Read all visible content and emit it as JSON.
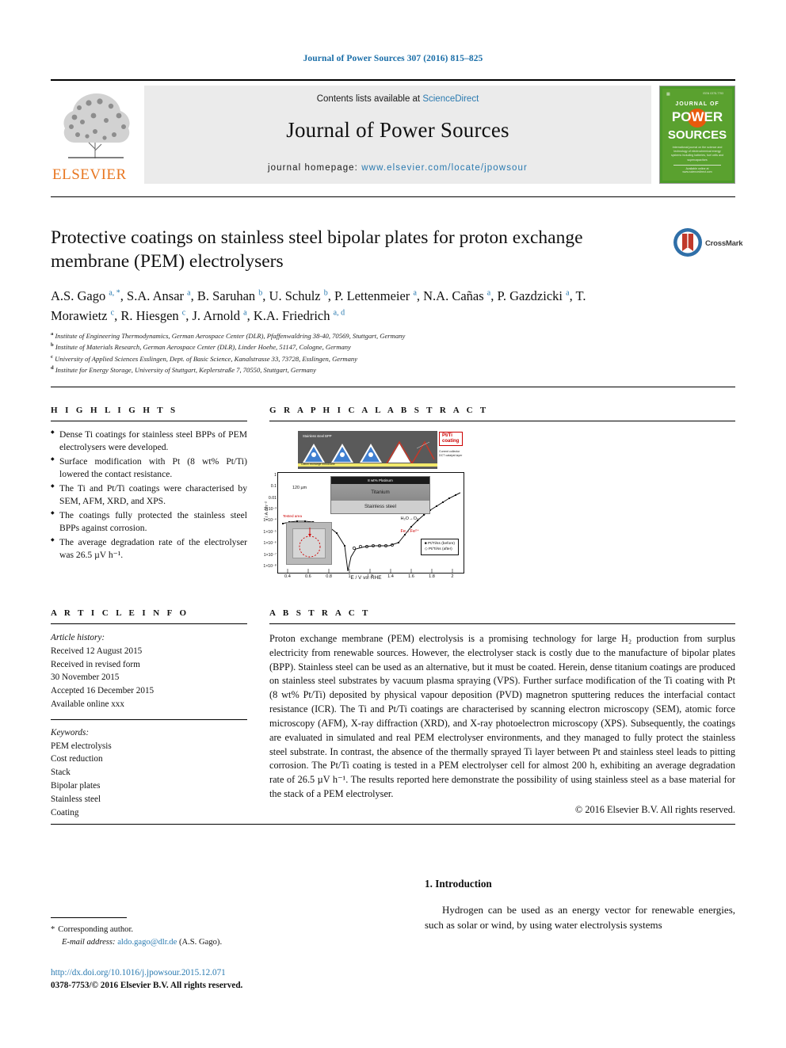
{
  "running_head": "Journal of Power Sources 307 (2016) 815–825",
  "masthead": {
    "contents_prefix": "Contents lists available at ",
    "sciencedirect": "ScienceDirect",
    "journal_title": "Journal of Power Sources",
    "homepage_prefix": "journal homepage: ",
    "homepage_url": "www.elsevier.com/locate/jpowsour",
    "publisher": "ELSEVIER",
    "publisher_icon": "elsevier-tree-logo",
    "cover": {
      "top_left": "ELSEVIER",
      "top_right": "ISSN 0378-7753",
      "line1": "JOURNAL OF",
      "line2": "POWER",
      "line3": "SOURCES",
      "blurb": "International journal on the science and technology of electrochemical energy systems including batteries, fuel cells and supercapacitors",
      "footer": "Available online at www.sciencedirect.com"
    }
  },
  "article": {
    "title": "Protective coatings on stainless steel bipolar plates for proton exchange membrane (PEM) electrolysers",
    "crossmark_label": "CrossMark",
    "authors_html": "A.S. Gago <sup>a, *</sup>, S.A. Ansar <sup>a</sup>, B. Saruhan <sup>b</sup>, U. Schulz <sup>b</sup>, P. Lettenmeier <sup>a</sup>, N.A. Cañas <sup>a</sup>, P. Gazdzicki <sup>a</sup>, T. Morawietz <sup>c</sup>, R. Hiesgen <sup>c</sup>, J. Arnold <sup>a</sup>, K.A. Friedrich <sup>a, d</sup>",
    "affiliations": [
      {
        "marker": "a",
        "text": "Institute of Engineering Thermodynamics, German Aerospace Center (DLR), Pfaffenwaldring 38-40, 70569, Stuttgart, Germany"
      },
      {
        "marker": "b",
        "text": "Institute of Materials Research, German Aerospace Center (DLR), Linder Hoehe, 51147, Cologne, Germany"
      },
      {
        "marker": "c",
        "text": "University of Applied Sciences Esslingen, Dept. of Basic Science, Kanalstrasse 33, 73728, Esslingen, Germany"
      },
      {
        "marker": "d",
        "text": "Institute for Energy Storage, University of Stuttgart, Keplerstraße 7, 70550, Stuttgart, Germany"
      }
    ]
  },
  "highlights": {
    "heading": "H I G H L I G H T S",
    "items": [
      "Dense Ti coatings for stainless steel BPPs of PEM electrolysers were developed.",
      "Surface modification with Pt (8 wt% Pt/Ti) lowered the contact resistance.",
      "The Ti and Pt/Ti coatings were characterised by SEM, AFM, XRD, and XPS.",
      "The coatings fully protected the stainless steel BPPs against corrosion.",
      "The average degradation rate of the electrolyser was 26.5 µV h⁻¹."
    ]
  },
  "article_info": {
    "heading": "A R T I C L E   I N F O",
    "history_label": "Article history:",
    "history": [
      "Received 12 August 2015",
      "Received in revised form",
      "30 November 2015",
      "Accepted 16 December 2015",
      "Available online xxx"
    ],
    "keywords_label": "Keywords:",
    "keywords": [
      "PEM electrolysis",
      "Cost reduction",
      "Stack",
      "Bipolar plates",
      "Stainless steel",
      "Coating"
    ]
  },
  "graphical_abstract": {
    "heading": "G R A P H I C A L   A B S T R A C T",
    "schematic": {
      "top_label": "Stainless steel BPP",
      "inner_label": "Current collector",
      "membrane_label": "Cation exchange membrane",
      "callout": "Pt/Ti coating",
      "notes": "Current collector\nDCT catalyst layer"
    },
    "sem_inset": {
      "pt_band": "8 wt% Platinum",
      "ti_band": "Titanium",
      "ss_band": "Stainless steel",
      "scale": "120 µm"
    },
    "photo_label": "Tested area",
    "legend": [
      "Pt/Ti/ss (before)",
      "Pt/Ti/ss (after)"
    ],
    "annotations": [
      "H₂O→O₂",
      "Fe→Fe²⁺"
    ]
  },
  "chart_data": {
    "type": "line",
    "title": "",
    "xlabel": "E / V vs. RHE",
    "ylabel": "i / A cm⁻²",
    "xlim": [
      0.3,
      2.05
    ],
    "xticks": [
      0.4,
      0.6,
      0.8,
      1,
      1.2,
      1.4,
      1.6,
      1.8,
      2
    ],
    "yscale": "log",
    "ylim": [
      1e-08,
      1
    ],
    "yticks": [
      "1",
      "0.1",
      "0.01",
      "1×10⁻³",
      "1×10⁻⁴",
      "1×10⁻⁵",
      "1×10⁻⁶",
      "1×10⁻⁷",
      "1×10⁻⁸"
    ],
    "grid": false,
    "legend_position": "bottom-right",
    "series": [
      {
        "name": "Pt/Ti/ss (before)",
        "marker": "filled-square",
        "x": [
          0.35,
          0.4,
          0.45,
          0.5,
          0.55,
          0.6,
          0.65,
          0.7,
          0.75,
          0.8,
          0.85,
          0.88,
          0.9,
          0.92,
          0.95,
          1.0,
          1.05,
          1.1,
          1.2,
          1.3,
          1.4,
          1.45,
          1.5,
          1.55,
          1.6,
          1.65,
          1.7,
          1.75,
          1.8,
          1.85,
          1.9,
          1.95,
          2.0
        ],
        "y": [
          0.0002,
          0.00022,
          0.00024,
          0.00025,
          0.00025,
          0.00024,
          0.00022,
          0.00018,
          0.00012,
          5e-05,
          8e-06,
          1e-08,
          3e-07,
          2e-06,
          5e-06,
          6e-06,
          6e-06,
          6e-06,
          6e-06,
          7e-06,
          2e-05,
          8e-05,
          0.0003,
          0.0009,
          0.0025,
          0.005,
          0.009,
          0.015,
          0.022,
          0.03,
          0.04,
          0.05,
          0.06
        ]
      },
      {
        "name": "Pt/Ti/ss (after)",
        "marker": "open-diamond",
        "x": [
          0.95,
          1.0,
          1.05,
          1.1,
          1.15,
          1.2,
          1.25,
          1.3,
          1.35,
          1.4
        ],
        "y": [
          5e-06,
          6e-06,
          6e-06,
          6e-06,
          6e-06,
          6e-06,
          6.5e-06,
          7e-06,
          1e-05,
          3e-05
        ]
      }
    ]
  },
  "abstract": {
    "heading": "A B S T R A C T",
    "body": "Proton exchange membrane (PEM) electrolysis is a promising technology for large H₂ production from surplus electricity from renewable sources. However, the electrolyser stack is costly due to the manufacture of bipolar plates (BPP). Stainless steel can be used as an alternative, but it must be coated. Herein, dense titanium coatings are produced on stainless steel substrates by vacuum plasma spraying (VPS). Further surface modification of the Ti coating with Pt (8 wt% Pt/Ti) deposited by physical vapour deposition (PVD) magnetron sputtering reduces the interfacial contact resistance (ICR). The Ti and Pt/Ti coatings are characterised by scanning electron microscopy (SEM), atomic force microscopy (AFM), X-ray diffraction (XRD), and X-ray photoelectron microscopy (XPS). Subsequently, the coatings are evaluated in simulated and real PEM electrolyser environments, and they managed to fully protect the stainless steel substrate. In contrast, the absence of the thermally sprayed Ti layer between Pt and stainless steel leads to pitting corrosion. The Pt/Ti coating is tested in a PEM electrolyser cell for almost 200 h, exhibiting an average degradation rate of 26.5 µV h⁻¹. The results reported here demonstrate the possibility of using stainless steel as a base material for the stack of a PEM electrolyser.",
    "copyright": "© 2016 Elsevier B.V. All rights reserved."
  },
  "introduction": {
    "heading": "1.  Introduction",
    "paragraph": "Hydrogen can be used as an energy vector for renewable energies, such as solar or wind, by using water electrolysis systems"
  },
  "footer": {
    "corresponding_label": "Corresponding author.",
    "email_label": "E-mail address:",
    "email": "aldo.gago@dlr.de",
    "email_suffix": "(A.S. Gago).",
    "doi": "http://dx.doi.org/10.1016/j.jpowsour.2015.12.071",
    "issn": "0378-7753/© 2016 Elsevier B.V. All rights reserved."
  }
}
